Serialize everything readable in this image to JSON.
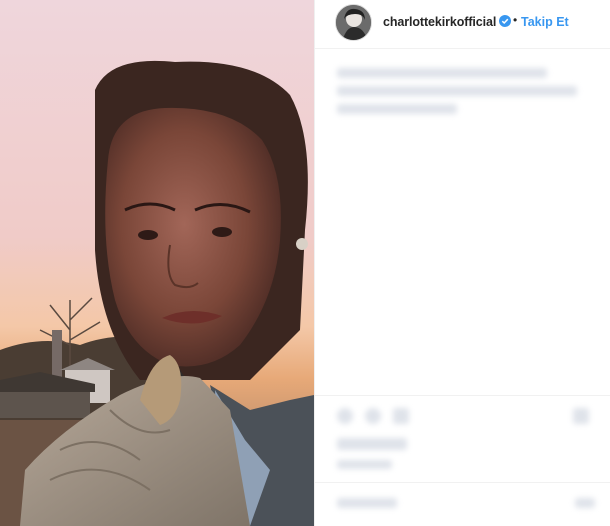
{
  "post": {
    "username": "charlottekirkofficial",
    "verified": true,
    "separator": "•",
    "follow_label": "Takip Et"
  },
  "icons": {
    "verified": "verified-badge-icon",
    "like": "heart-icon",
    "comment": "comment-icon",
    "share": "share-icon",
    "save": "bookmark-icon"
  },
  "colors": {
    "link": "#3897f0",
    "text": "#262626",
    "border": "#efefef"
  }
}
